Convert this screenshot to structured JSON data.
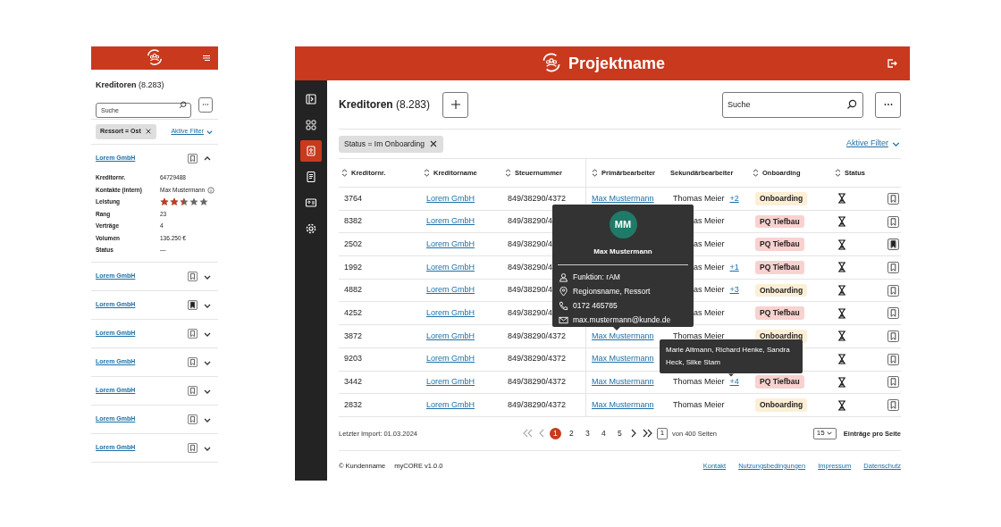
{
  "mobile": {
    "title": "Kreditoren",
    "count": "(8.283)",
    "search_placeholder": "Suche",
    "filter_chip": "Ressort = Ost",
    "filter_link": "Aktive Filter",
    "items": [
      {
        "name": "Lorem GmbH",
        "bookmarked": false,
        "expanded": true,
        "details": [
          {
            "kind": "text",
            "label": "Kreditornr.",
            "value": "64729488"
          },
          {
            "kind": "contact",
            "label": "Kontakte (intern)",
            "value": "Max Mustermann"
          },
          {
            "kind": "stars",
            "label": "Leistung",
            "stars": 2.5
          },
          {
            "kind": "text",
            "label": "Rang",
            "value": "23"
          },
          {
            "kind": "text",
            "label": "Verträge",
            "value": "4"
          },
          {
            "kind": "text",
            "label": "Volumen",
            "value": "136.250 €"
          },
          {
            "kind": "text",
            "label": "Status",
            "value": "—"
          }
        ]
      },
      {
        "name": "Lorem GmbH",
        "bookmarked": false,
        "expanded": false
      },
      {
        "name": "Lorem GmbH",
        "bookmarked": true,
        "expanded": false
      },
      {
        "name": "Lorem GmbH",
        "bookmarked": false,
        "expanded": false
      },
      {
        "name": "Lorem GmbH",
        "bookmarked": false,
        "expanded": false
      },
      {
        "name": "Lorem GmbH",
        "bookmarked": false,
        "expanded": false
      },
      {
        "name": "Lorem GmbH",
        "bookmarked": false,
        "expanded": false
      },
      {
        "name": "Lorem GmbH",
        "bookmarked": false,
        "expanded": false
      }
    ]
  },
  "header": {
    "title": "Projektname"
  },
  "sidebar": {
    "items": [
      {
        "kind": "panel",
        "selected": false
      },
      {
        "kind": "grid",
        "selected": false
      },
      {
        "kind": "contact",
        "selected": true
      },
      {
        "kind": "document",
        "selected": false
      },
      {
        "kind": "idcard",
        "selected": false
      },
      {
        "kind": "settings",
        "selected": false
      }
    ]
  },
  "page": {
    "title": "Kreditoren",
    "count": "(8.283)",
    "search_placeholder": "Suche",
    "filter_chip": "Status = Im Onboarding",
    "filter_link": "Aktive Filter"
  },
  "table": {
    "columns": [
      {
        "label": "Kreditornr.",
        "sortable": true
      },
      {
        "label": "Kreditorname",
        "sortable": true
      },
      {
        "label": "Steuernummer",
        "sortable": true
      },
      {
        "label": "Primärbearbeiter",
        "sortable": true
      },
      {
        "label": "Sekundärbearbeiter",
        "sortable": false
      },
      {
        "label": "Onboarding",
        "sortable": true
      },
      {
        "label": "Status",
        "sortable": true
      }
    ],
    "rows": [
      {
        "nr": "3764",
        "name": "Lorem GmbH",
        "tax": "849/38290/4372",
        "primary": "Max Mustermann",
        "secondary": "Thomas Meier",
        "extra": "+2",
        "onboarding": {
          "kind": "onboarding",
          "label": "Onboarding"
        },
        "bookmarked": false
      },
      {
        "nr": "8382",
        "name": "Lorem GmbH",
        "tax": "849/38290/4",
        "secondary": "as Meier",
        "onboarding": {
          "kind": "pq",
          "label": "PQ Tiefbau"
        },
        "bookmarked": false
      },
      {
        "nr": "2502",
        "name": "Lorem GmbH",
        "tax": "849/38290/4",
        "secondary": "as Meier",
        "onboarding": {
          "kind": "pq",
          "label": "PQ Tiefbau"
        },
        "bookmarked": true
      },
      {
        "nr": "1992",
        "name": "Lorem GmbH",
        "tax": "849/38290/4",
        "secondary": "as Meier",
        "extra": "+1",
        "onboarding": {
          "kind": "pq",
          "label": "PQ Tiefbau"
        },
        "bookmarked": false
      },
      {
        "nr": "4882",
        "name": "Lorem GmbH",
        "tax": "849/38290/4",
        "secondary": "as Meier",
        "extra": "+3",
        "onboarding": {
          "kind": "onboarding",
          "label": "Onboarding"
        },
        "bookmarked": false
      },
      {
        "nr": "4252",
        "name": "Lorem GmbH",
        "tax": "849/38290/4",
        "secondary": "as Meier",
        "onboarding": {
          "kind": "pq",
          "label": "PQ Tiefbau"
        },
        "bookmarked": false
      },
      {
        "nr": "3872",
        "name": "Lorem GmbH",
        "tax": "849/38290/4372",
        "primary": "Max Mustermann",
        "secondary": "Thomas Meier",
        "onboarding": {
          "kind": "onboarding",
          "label": "Onboarding"
        },
        "bookmarked": false
      },
      {
        "nr": "9203",
        "name": "Lorem GmbH",
        "tax": "849/38290/4372",
        "primary": "Max Mustermann",
        "bookmarked": false
      },
      {
        "nr": "3442",
        "name": "Lorem GmbH",
        "tax": "849/38290/4372",
        "primary": "Max Mustermann",
        "secondary": "Thomas Meier",
        "extra": "+4",
        "onboarding": {
          "kind": "pq",
          "label": "PQ Tiefbau"
        },
        "bookmarked": false
      },
      {
        "nr": "2832",
        "name": "Lorem GmbH",
        "tax": "849/38290/4372",
        "primary": "Max Mustermann",
        "secondary": "Thomas Meier",
        "onboarding": {
          "kind": "onboarding",
          "label": "Onboarding"
        },
        "bookmarked": false
      }
    ]
  },
  "pagination": {
    "last_import": "Letzter Import: 01.03.2024",
    "pages": [
      {
        "label": "1",
        "selected": true
      },
      {
        "label": "2",
        "selected": false
      },
      {
        "label": "3",
        "selected": false
      },
      {
        "label": "4",
        "selected": false
      },
      {
        "label": "5",
        "selected": false
      }
    ],
    "page_input": "1",
    "of_pages": "von 400 Seiten",
    "per_page": "15",
    "per_page_label": "Einträge pro Seite"
  },
  "footer": {
    "copyright": "© Kundenname",
    "version": "myCORE v1.0.0",
    "links": [
      "Kontakt",
      "Nutzungsbedingungen",
      "Impressum",
      "Datenschutz"
    ]
  },
  "contact_tooltip": {
    "initials": "MM",
    "name": "Max Mustermann",
    "lines": [
      {
        "kind": "role",
        "text": "Funktion: rAM"
      },
      {
        "kind": "location",
        "text": "Regionsname, Ressort"
      },
      {
        "kind": "phone",
        "text": "0172 465785"
      },
      {
        "kind": "email",
        "text": "max.mustermann@kunde.de"
      }
    ]
  },
  "names_tooltip": {
    "text": "Marie Altmann, Richard Henke, Sandra Heck, Silke Stam"
  }
}
